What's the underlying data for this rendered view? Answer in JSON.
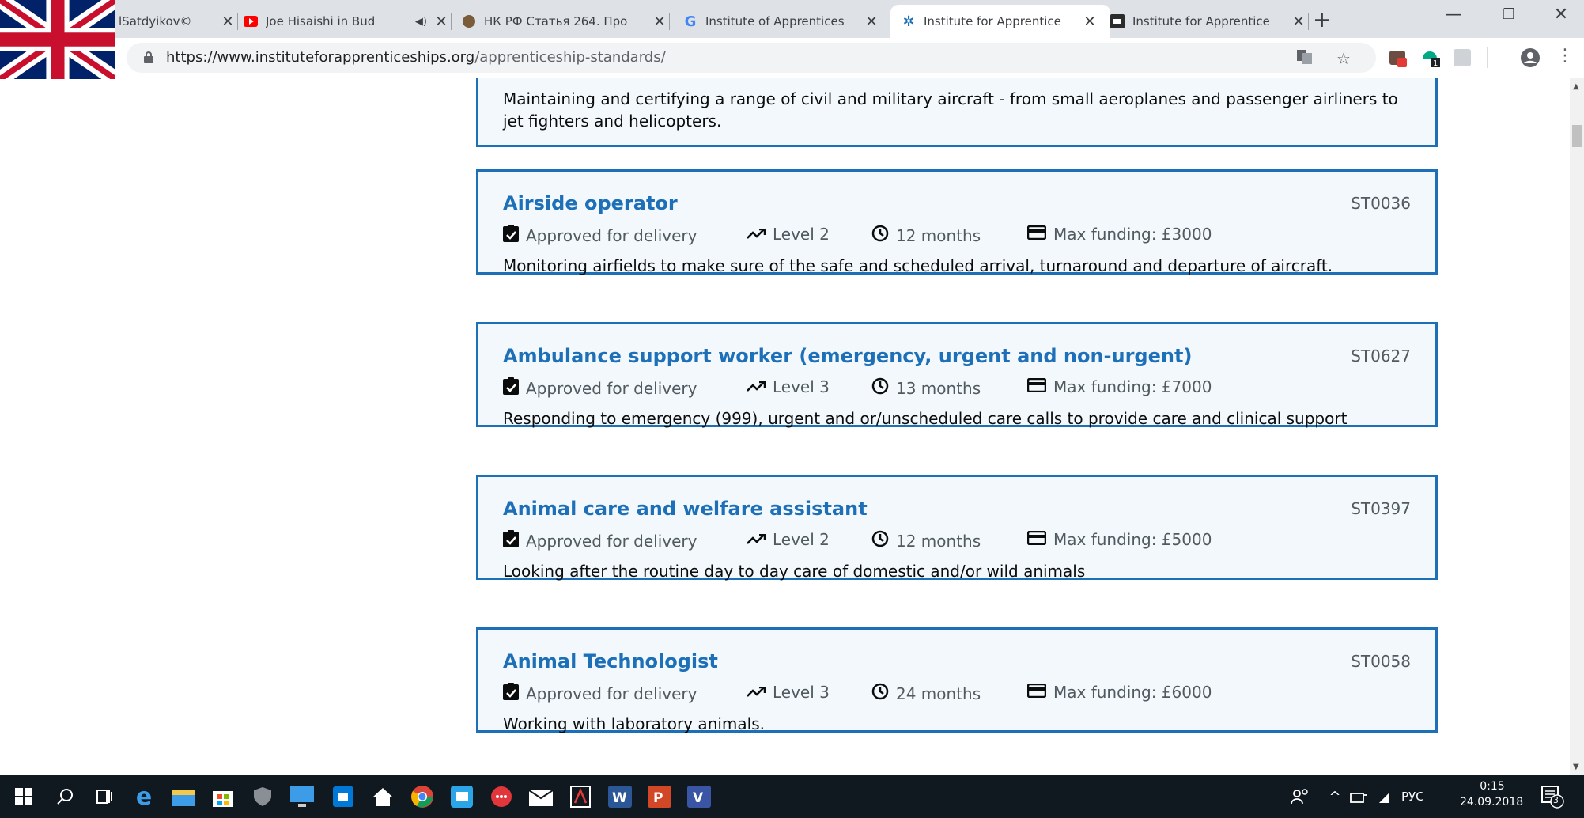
{
  "browser": {
    "tabs": [
      {
        "title": "lSatdyikov©"
      },
      {
        "title": "Joe Hisaishi in Bud"
      },
      {
        "title": "НК РФ Статья 264. Про"
      },
      {
        "title": "Institute of Apprentices"
      },
      {
        "title": "Institute for Apprentice"
      },
      {
        "title": "Institute for Apprentice"
      }
    ],
    "new_tab": "+",
    "url_host": "https://www.instituteforapprenticeships.org",
    "url_path": "/apprenticeship-standards/"
  },
  "page": {
    "top_card_desc": "Maintaining and certifying a range of civil and military aircraft - from small aeroplanes and passenger airliners to jet fighters and helicopters.",
    "standards": [
      {
        "title": "Airside operator",
        "code": "ST0036",
        "status": "Approved for delivery",
        "level": "Level 2",
        "duration": "12 months",
        "funding": "Max funding: £3000",
        "desc": "Monitoring airfields to make sure of the safe and scheduled arrival, turnaround and departure of aircraft."
      },
      {
        "title": "Ambulance support worker (emergency, urgent and non-urgent)",
        "code": "ST0627",
        "status": "Approved for delivery",
        "level": "Level 3",
        "duration": "13 months",
        "funding": "Max funding: £7000",
        "desc": "Responding to emergency (999), urgent and or/unscheduled care calls to provide care and clinical support"
      },
      {
        "title": "Animal care and welfare assistant",
        "code": "ST0397",
        "status": "Approved for delivery",
        "level": "Level 2",
        "duration": "12 months",
        "funding": "Max funding: £5000",
        "desc": "Looking after the routine day to day care of domestic and/or wild animals"
      },
      {
        "title": "Animal Technologist",
        "code": "ST0058",
        "status": "Approved for delivery",
        "level": "Level 3",
        "duration": "24 months",
        "funding": "Max funding: £6000",
        "desc": "Working with laboratory animals."
      }
    ]
  },
  "taskbar": {
    "language": "РУС",
    "time": "0:15",
    "date": "24.09.2018",
    "notifications": "3"
  },
  "colors": {
    "link": "#1d70b8",
    "card_bg": "#f3f8fc",
    "taskbar": "#101820"
  }
}
